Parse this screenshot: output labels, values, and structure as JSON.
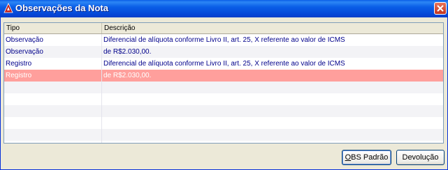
{
  "window": {
    "title": "Observações da Nota"
  },
  "grid": {
    "columns": [
      "Tipo",
      "Descrição"
    ],
    "rows": [
      {
        "tipo": "Observação",
        "descricao": "Diferencial de alíquota conforme Livro II, art. 25, X referente ao valor de ICMS",
        "selected": false
      },
      {
        "tipo": "Observação",
        "descricao": "de R$2.030,00.",
        "selected": false
      },
      {
        "tipo": "Registro",
        "descricao": "Diferencial de alíquota conforme Livro II, art. 25, X referente ao valor de ICMS",
        "selected": false
      },
      {
        "tipo": "Registro",
        "descricao": "de R$2.030,00.",
        "selected": true
      }
    ]
  },
  "buttons": {
    "obs_padrao_mnemonic": "O",
    "obs_padrao_rest": "BS Padrão",
    "devolucao": "Devolução"
  },
  "colors": {
    "selection": "#ff9f9c",
    "text": "#00008b",
    "titlebar": "#0a5ee7"
  }
}
